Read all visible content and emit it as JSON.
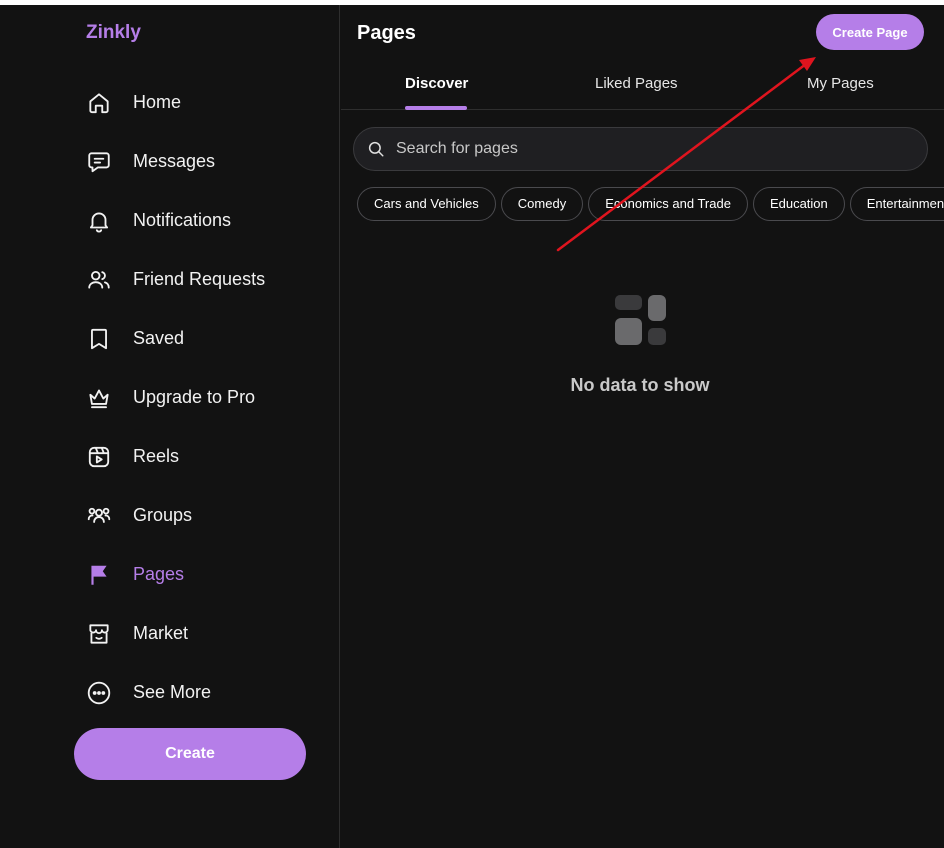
{
  "app": {
    "name": "Zinkly"
  },
  "sidebar": {
    "items": [
      {
        "label": "Home",
        "icon": "home-icon"
      },
      {
        "label": "Messages",
        "icon": "message-icon"
      },
      {
        "label": "Notifications",
        "icon": "bell-icon"
      },
      {
        "label": "Friend Requests",
        "icon": "users-icon"
      },
      {
        "label": "Saved",
        "icon": "bookmark-icon"
      },
      {
        "label": "Upgrade to Pro",
        "icon": "crown-icon"
      },
      {
        "label": "Reels",
        "icon": "reels-icon"
      },
      {
        "label": "Groups",
        "icon": "group-icon"
      },
      {
        "label": "Pages",
        "icon": "flag-icon",
        "active": true
      },
      {
        "label": "Market",
        "icon": "store-icon"
      },
      {
        "label": "See More",
        "icon": "more-icon"
      }
    ],
    "create_label": "Create"
  },
  "main": {
    "title": "Pages",
    "create_page_label": "Create Page",
    "tabs": [
      {
        "label": "Discover",
        "active": true
      },
      {
        "label": "Liked Pages"
      },
      {
        "label": "My Pages"
      }
    ],
    "search": {
      "placeholder": "Search for pages"
    },
    "categories": [
      "Cars and Vehicles",
      "Comedy",
      "Economics and Trade",
      "Education",
      "Entertainment"
    ],
    "empty_state": "No data to show"
  },
  "colors": {
    "accent": "#b57ee8",
    "background": "#121212",
    "annotation_arrow": "#e0141e"
  }
}
